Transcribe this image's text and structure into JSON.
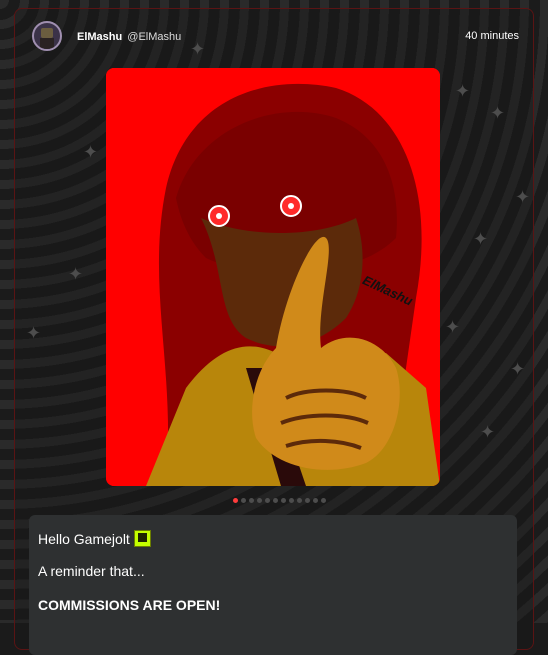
{
  "post": {
    "display_name": "ElMashu",
    "handle": "@ElMashu",
    "time": "40 minutes"
  },
  "media": {
    "watermark": "ElMashu",
    "dots_count": 12,
    "active_dot": 0,
    "accent": "#ff0000"
  },
  "content": {
    "line1": "Hello Gamejolt",
    "line2": "A reminder that...",
    "line3": "COMMISSIONS ARE OPEN!"
  }
}
